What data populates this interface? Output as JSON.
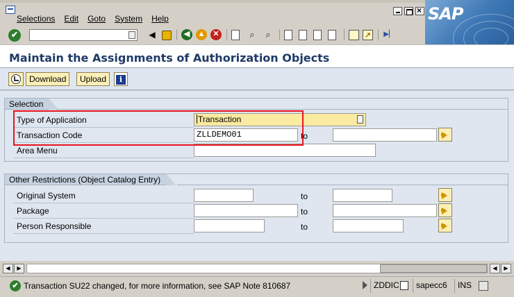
{
  "menu": {
    "items": [
      "Selections",
      "Edit",
      "Goto",
      "System",
      "Help"
    ]
  },
  "brand": {
    "logo_text": "SAP"
  },
  "toolbar": {
    "command_field_value": "",
    "icons": [
      "enter-icon",
      "back-icon",
      "save-icon",
      "back-green-icon",
      "exit-icon",
      "cancel-icon",
      "print-icon",
      "find-icon",
      "find-next-icon",
      "first-page-icon",
      "previous-page-icon",
      "next-page-icon",
      "last-page-icon",
      "create-session-icon",
      "shortcut-icon",
      "help-icon",
      "customize-layout-icon"
    ]
  },
  "page": {
    "title": "Maintain the Assignments of Authorization Objects"
  },
  "app_toolbar": {
    "download_label": "Download",
    "upload_label": "Upload"
  },
  "selection": {
    "title": "Selection",
    "type_label": "Type of Application",
    "type_value": "Transaction",
    "tcode_label": "Transaction Code",
    "tcode_value": "ZLLDEMO01",
    "tcode_to_label": "to",
    "tcode_to_value": "",
    "area_label": "Area Menu",
    "area_value": ""
  },
  "other": {
    "title": "Other Restrictions (Object Catalog Entry)",
    "rows": [
      {
        "label": "Original System",
        "from": "",
        "to_label": "to",
        "to": ""
      },
      {
        "label": "Package",
        "from": "",
        "to_label": "to",
        "to": ""
      },
      {
        "label": "Person Responsible",
        "from": "",
        "to_label": "to",
        "to": ""
      }
    ]
  },
  "status": {
    "message": "Transaction SU22 changed, for more information, see SAP Note 810687",
    "system": "ZDDIC",
    "host": "sapecc6",
    "mode": "INS"
  },
  "colors": {
    "required_field": "#fbeaa2",
    "highlight": "#e8141e",
    "title_text": "#1f3a66"
  }
}
